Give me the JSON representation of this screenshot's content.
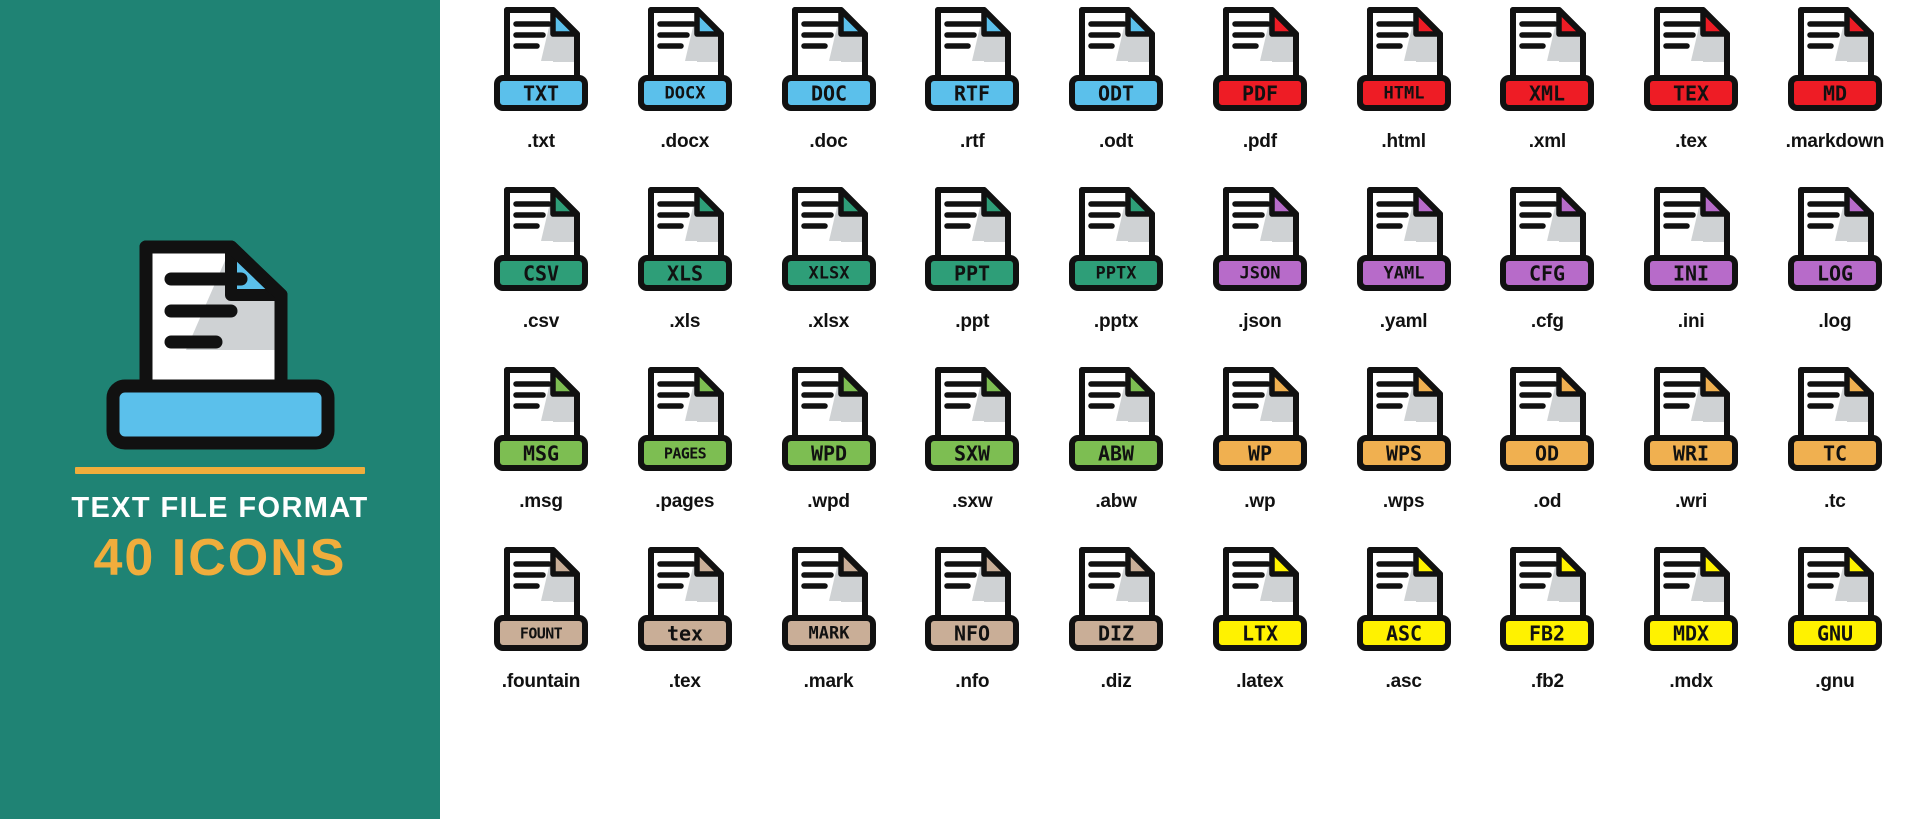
{
  "cover": {
    "title": "TEXT FILE FORMAT",
    "count": "40 ICONS",
    "background_color": "#1F8374",
    "accent_color": "#F0AD3C",
    "icon_name": "text-file-document-icon",
    "icon_page_color": "#FFFFFF",
    "icon_fold_color": "#5BC0EB",
    "icon_bar_color": "#5BC0EB",
    "icon_shadow_color": "#CFD2D4"
  },
  "palette": {
    "blue": "#5BC0EB",
    "red": "#EE1C25",
    "teal": "#2E9E78",
    "purple": "#B76BC9",
    "green": "#7DBE52",
    "orange": "#F0B050",
    "tan": "#C9AE97",
    "yellow": "#FFF200",
    "outline": "#111111",
    "page": "#FFFFFF",
    "shadow": "#CFD2D4"
  },
  "rows": [
    {
      "row_name": "row-1",
      "icons": [
        {
          "badge": "TXT",
          "ext": ".txt",
          "color_key": "blue"
        },
        {
          "badge": "DOCX",
          "ext": ".docx",
          "color_key": "blue"
        },
        {
          "badge": "DOC",
          "ext": ".doc",
          "color_key": "blue"
        },
        {
          "badge": "RTF",
          "ext": ".rtf",
          "color_key": "blue"
        },
        {
          "badge": "ODT",
          "ext": ".odt",
          "color_key": "blue"
        },
        {
          "badge": "PDF",
          "ext": ".pdf",
          "color_key": "red"
        },
        {
          "badge": "HTML",
          "ext": ".html",
          "color_key": "red"
        },
        {
          "badge": "XML",
          "ext": ".xml",
          "color_key": "red"
        },
        {
          "badge": "TEX",
          "ext": ".tex",
          "color_key": "red"
        },
        {
          "badge": "MD",
          "ext": ".markdown",
          "color_key": "red"
        }
      ]
    },
    {
      "row_name": "row-2",
      "icons": [
        {
          "badge": "CSV",
          "ext": ".csv",
          "color_key": "teal"
        },
        {
          "badge": "XLS",
          "ext": ".xls",
          "color_key": "teal"
        },
        {
          "badge": "XLSX",
          "ext": ".xlsx",
          "color_key": "teal"
        },
        {
          "badge": "PPT",
          "ext": ".ppt",
          "color_key": "teal"
        },
        {
          "badge": "PPTX",
          "ext": ".pptx",
          "color_key": "teal"
        },
        {
          "badge": "JSON",
          "ext": ".json",
          "color_key": "purple"
        },
        {
          "badge": "YAML",
          "ext": ".yaml",
          "color_key": "purple"
        },
        {
          "badge": "CFG",
          "ext": ".cfg",
          "color_key": "purple"
        },
        {
          "badge": "INI",
          "ext": ".ini",
          "color_key": "purple"
        },
        {
          "badge": "LOG",
          "ext": ".log",
          "color_key": "purple"
        }
      ]
    },
    {
      "row_name": "row-3",
      "icons": [
        {
          "badge": "MSG",
          "ext": ".msg",
          "color_key": "green"
        },
        {
          "badge": "PAGES",
          "ext": ".pages",
          "color_key": "green"
        },
        {
          "badge": "WPD",
          "ext": ".wpd",
          "color_key": "green"
        },
        {
          "badge": "SXW",
          "ext": ".sxw",
          "color_key": "green"
        },
        {
          "badge": "ABW",
          "ext": ".abw",
          "color_key": "green"
        },
        {
          "badge": "WP",
          "ext": ".wp",
          "color_key": "orange"
        },
        {
          "badge": "WPS",
          "ext": ".wps",
          "color_key": "orange"
        },
        {
          "badge": "OD",
          "ext": ".od",
          "color_key": "orange"
        },
        {
          "badge": "WRI",
          "ext": ".wri",
          "color_key": "orange"
        },
        {
          "badge": "TC",
          "ext": ".tc",
          "color_key": "orange"
        }
      ]
    },
    {
      "row_name": "row-4",
      "icons": [
        {
          "badge": "FOUNT",
          "ext": ".fountain",
          "color_key": "tan"
        },
        {
          "badge": "tex",
          "ext": ".tex",
          "color_key": "tan"
        },
        {
          "badge": "MARK",
          "ext": ".mark",
          "color_key": "tan"
        },
        {
          "badge": "NFO",
          "ext": ".nfo",
          "color_key": "tan"
        },
        {
          "badge": "DIZ",
          "ext": ".diz",
          "color_key": "tan"
        },
        {
          "badge": "LTX",
          "ext": ".latex",
          "color_key": "yellow"
        },
        {
          "badge": "ASC",
          "ext": ".asc",
          "color_key": "yellow"
        },
        {
          "badge": "FB2",
          "ext": ".fb2",
          "color_key": "yellow"
        },
        {
          "badge": "MDX",
          "ext": ".mdx",
          "color_key": "yellow"
        },
        {
          "badge": "GNU",
          "ext": ".gnu",
          "color_key": "yellow"
        }
      ]
    }
  ]
}
